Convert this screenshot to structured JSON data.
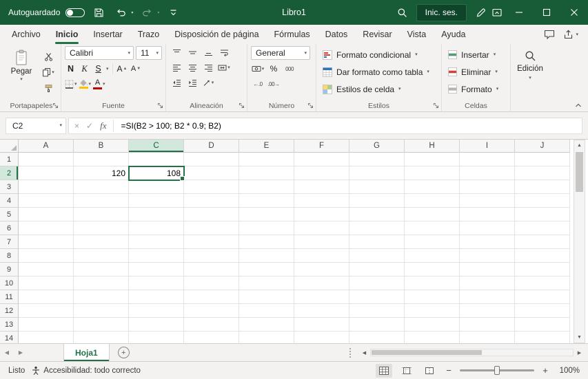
{
  "colors": {
    "titlebar": "#185C37",
    "accent": "#217346",
    "selection_border": "#217346",
    "selected_header_bg": "#D3E8DC"
  },
  "icons": {
    "chevron_down": "▾",
    "arrow_left": "◀",
    "arrow_right": "▶",
    "arrow_up": "▲",
    "arrow_down": "▼",
    "cancel": "×",
    "check": "✓",
    "plus": "+",
    "minus": "−"
  },
  "title_bar": {
    "autosave_label": "Autoguardado",
    "document_title": "Libro1",
    "sign_in_label": "Inic. ses."
  },
  "ribbon_tabs": [
    {
      "label": "Archivo",
      "active": false
    },
    {
      "label": "Inicio",
      "active": true
    },
    {
      "label": "Insertar",
      "active": false
    },
    {
      "label": "Trazo",
      "active": false
    },
    {
      "label": "Disposición de página",
      "active": false
    },
    {
      "label": "Fórmulas",
      "active": false
    },
    {
      "label": "Datos",
      "active": false
    },
    {
      "label": "Revisar",
      "active": false
    },
    {
      "label": "Vista",
      "active": false
    },
    {
      "label": "Ayuda",
      "active": false
    }
  ],
  "ribbon": {
    "paste_label": "Pegar",
    "font_name": "Calibri",
    "font_size": "11",
    "bold_label": "N",
    "italic_label": "K",
    "underline_label": "S",
    "grow_font_label": "A",
    "shrink_font_label": "A",
    "font_color_label": "A",
    "number_format": "General",
    "percent_label": "%",
    "thousands_label": "000",
    "inc_decimals_label": "←.0",
    "dec_decimals_label": ".00→",
    "styles_buttons": [
      "Formato condicional",
      "Dar formato como tabla",
      "Estilos de celda"
    ],
    "cells_buttons": [
      "Insertar",
      "Eliminar",
      "Formato"
    ],
    "editing_label": "Edición",
    "group_labels": [
      "Portapapeles",
      "Fuente",
      "Alineación",
      "Número",
      "Estilos",
      "Celdas"
    ]
  },
  "formula_bar": {
    "name_box": "C2",
    "fx_label": "fx",
    "formula": "=SI(B2 > 100; B2 * 0.9; B2)"
  },
  "grid": {
    "columns": [
      "A",
      "B",
      "C",
      "D",
      "E",
      "F",
      "G",
      "H",
      "I",
      "J"
    ],
    "row_count": 14,
    "cells": {
      "B2": "120",
      "C2": "108"
    },
    "selection": {
      "cell": "C2",
      "col": "C",
      "row": 2
    }
  },
  "sheet_bar": {
    "sheets": [
      {
        "name": "Hoja1",
        "active": true
      }
    ]
  },
  "status_bar": {
    "mode": "Listo",
    "accessibility": "Accesibilidad: todo correcto",
    "zoom": "100%"
  }
}
